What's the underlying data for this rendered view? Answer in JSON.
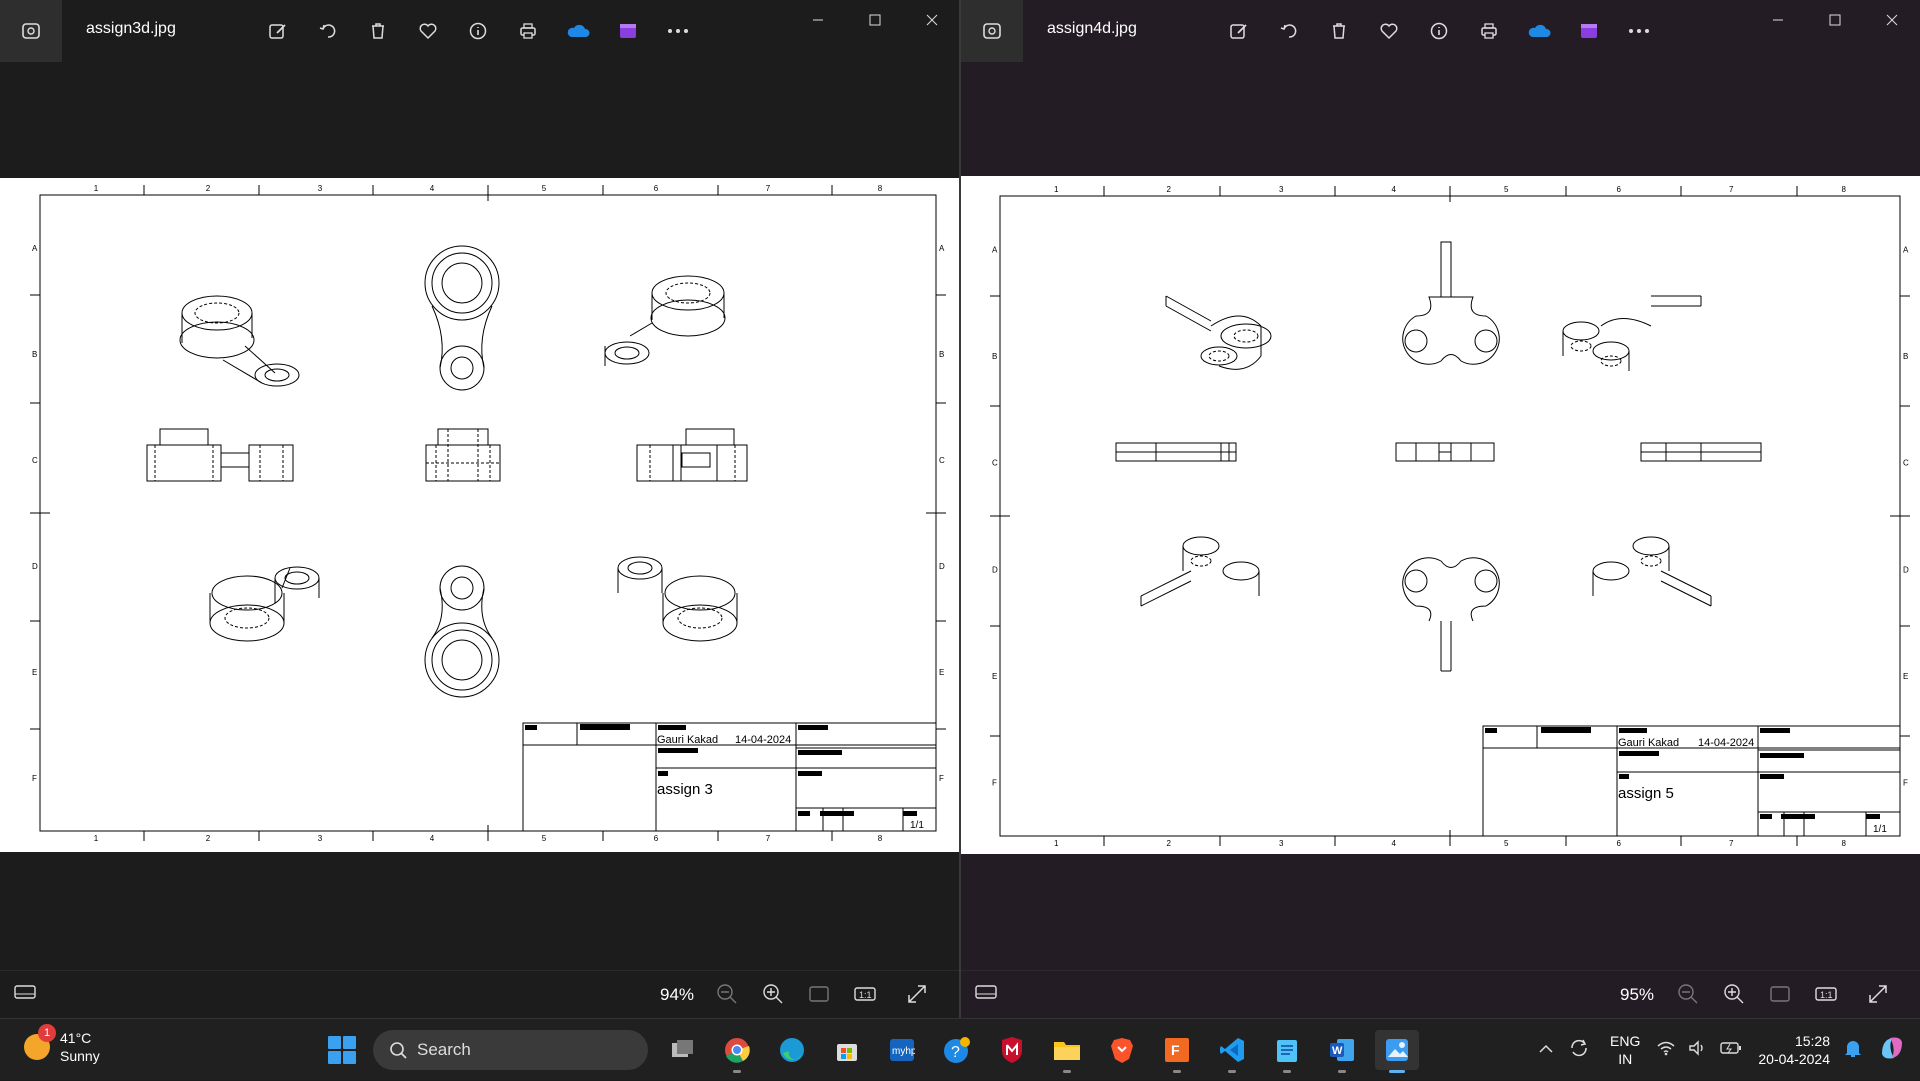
{
  "left_window": {
    "file_name": "assign3d.jpg",
    "zoom": "94%",
    "drawing": {
      "author": "Gauri Kakad",
      "date": "14-04-2024",
      "title": "assign 3",
      "sheet": "1/1",
      "col_labels": [
        "1",
        "2",
        "3",
        "4",
        "5",
        "6",
        "7",
        "8"
      ],
      "row_labels": [
        "A",
        "B",
        "C",
        "D",
        "E",
        "F"
      ]
    }
  },
  "right_window": {
    "file_name": "assign4d.jpg",
    "zoom": "95%",
    "drawing": {
      "author": "Gauri Kakad",
      "date": "14-04-2024",
      "title": "assign 5",
      "sheet": "1/1",
      "col_labels": [
        "1",
        "2",
        "3",
        "4",
        "5",
        "6",
        "7",
        "8"
      ],
      "row_labels": [
        "A",
        "B",
        "C",
        "D",
        "E",
        "F"
      ]
    }
  },
  "toolbar_icons": [
    "edit-icon",
    "rotate-icon",
    "delete-icon",
    "favorite-icon",
    "info-icon",
    "print-icon",
    "onedrive-icon",
    "clipchamp-icon",
    "more-icon"
  ],
  "taskbar": {
    "weather": {
      "badge": "1",
      "temp": "41°C",
      "condition": "Sunny"
    },
    "search_label": "Search",
    "apps": [
      "task-view",
      "chrome",
      "edge",
      "store",
      "myhp",
      "help",
      "mcafee",
      "file-explorer",
      "brave",
      "fusion",
      "vscode",
      "notepad",
      "word",
      "photos"
    ],
    "lang_line1": "ENG",
    "lang_line2": "IN",
    "time": "15:28",
    "date": "20-04-2024"
  }
}
